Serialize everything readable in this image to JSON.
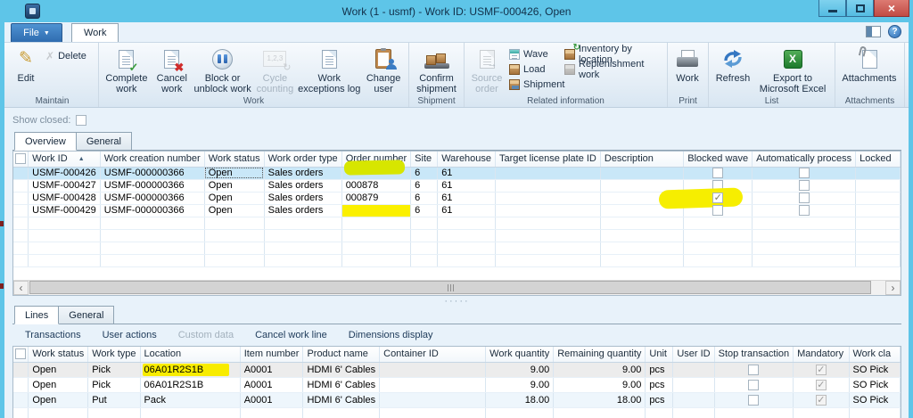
{
  "window": {
    "title": "Work (1 - usmf) - Work ID: USMF-000426, Open"
  },
  "titlebar": {
    "close_glyph": "×"
  },
  "icons": {
    "check": "✓",
    "cross": "✖",
    "arrow": "→",
    "cycle": "↻"
  },
  "tabrow": {
    "file_label": "File",
    "file_caret": "▼",
    "work_tab": "Work",
    "help_glyph": "?"
  },
  "ribbon": {
    "maintain": {
      "group_label": "Maintain",
      "edit": "Edit",
      "edit_glyph": "✎",
      "delete": "Delete",
      "delete_glyph": "✗"
    },
    "work": {
      "group_label": "Work",
      "complete": "Complete work",
      "cancel": "Cancel work",
      "block": "Block or unblock work",
      "cycle": "Cycle counting",
      "cycle_icon_text": "1,2,3",
      "exceptions": "Work exceptions log",
      "change_user": "Change user"
    },
    "shipment_group": {
      "group_label": "Shipment",
      "confirm": "Confirm shipment"
    },
    "related": {
      "group_label": "Related information",
      "source_order": "Source order",
      "wave": "Wave",
      "load": "Load",
      "shipment": "Shipment",
      "inventory": "Inventory by location",
      "replenishment": "Replenishment work"
    },
    "print_group": {
      "group_label": "Print",
      "work_btn": "Work"
    },
    "list_group": {
      "group_label": "List",
      "refresh": "Refresh",
      "export_excel": "Export to Microsoft Excel"
    },
    "attachments_group": {
      "group_label": "Attachments",
      "attachments": "Attachments"
    }
  },
  "filters": {
    "show_closed_label": "Show closed:"
  },
  "work_pane": {
    "tabs": [
      "Overview",
      "General"
    ],
    "sort_glyph": "▲",
    "columns": [
      "Work ID",
      "Work creation number",
      "Work status",
      "Work order type",
      "Order number",
      "Site",
      "Warehouse",
      "Target license plate ID",
      "Description",
      "Blocked wave",
      "Automatically process",
      "Locked"
    ],
    "rows": [
      {
        "work_id": "USMF-000426",
        "creation_number": "USMF-000000366",
        "work_status": "Open",
        "work_order_type": "Sales orders",
        "order_number": "",
        "site": "6",
        "warehouse": "61",
        "target_lp": "",
        "description": "",
        "blocked_wave": false,
        "auto_process": false,
        "selected": true,
        "focus": "work_status",
        "hl": {
          "order_number": "top"
        }
      },
      {
        "work_id": "USMF-000427",
        "creation_number": "USMF-000000366",
        "work_status": "Open",
        "work_order_type": "Sales orders",
        "order_number": "000878",
        "site": "6",
        "warehouse": "61",
        "target_lp": "",
        "description": "",
        "blocked_wave": false,
        "auto_process": false
      },
      {
        "work_id": "USMF-000428",
        "creation_number": "USMF-000000366",
        "work_status": "Open",
        "work_order_type": "Sales orders",
        "order_number": "000879",
        "site": "6",
        "warehouse": "61",
        "target_lp": "",
        "description": "",
        "blocked_wave": true,
        "auto_process": false,
        "hl": {
          "blocked_wave": "blob"
        }
      },
      {
        "work_id": "USMF-000429",
        "creation_number": "USMF-000000366",
        "work_status": "Open",
        "work_order_type": "Sales orders",
        "order_number": "",
        "site": "6",
        "warehouse": "61",
        "target_lp": "",
        "description": "",
        "blocked_wave": false,
        "auto_process": false,
        "hl": {
          "order_number": "fill"
        }
      }
    ]
  },
  "splitter": {
    "dots": "·····"
  },
  "scrollbar": {
    "left_glyph": "‹",
    "right_glyph": "›"
  },
  "lines_pane": {
    "tabs": [
      "Lines",
      "General"
    ],
    "actions": [
      {
        "label": "Transactions",
        "enabled": true
      },
      {
        "label": "User actions",
        "enabled": true
      },
      {
        "label": "Custom data",
        "enabled": false
      },
      {
        "label": "Cancel work line",
        "enabled": true
      },
      {
        "label": "Dimensions display",
        "enabled": true
      }
    ],
    "columns": [
      "Work status",
      "Work type",
      "Location",
      "Item number",
      "Product name",
      "Container ID",
      "Work quantity",
      "Remaining quantity",
      "Unit",
      "User ID",
      "Stop transaction",
      "Mandatory",
      "Work cla"
    ],
    "rows": [
      {
        "work_status": "Open",
        "work_type": "Pick",
        "location": "06A01R2S1B",
        "item_number": "A0001",
        "product_name": "HDMI 6' Cables",
        "container_id": "",
        "work_qty": "9.00",
        "remaining_qty": "9.00",
        "unit": "pcs",
        "user_id": "",
        "stop_transaction": false,
        "mandatory": true,
        "work_class": "SO Pick",
        "selected": true,
        "hl": {
          "location": "text"
        }
      },
      {
        "work_status": "Open",
        "work_type": "Pick",
        "location": "06A01R2S1B",
        "item_number": "A0001",
        "product_name": "HDMI 6' Cables",
        "container_id": "",
        "work_qty": "9.00",
        "remaining_qty": "9.00",
        "unit": "pcs",
        "user_id": "",
        "stop_transaction": false,
        "mandatory": true,
        "work_class": "SO Pick"
      },
      {
        "work_status": "Open",
        "work_type": "Put",
        "location": "Pack",
        "item_number": "A0001",
        "product_name": "HDMI 6' Cables",
        "container_id": "",
        "work_qty": "18.00",
        "remaining_qty": "18.00",
        "unit": "pcs",
        "user_id": "",
        "stop_transaction": false,
        "mandatory": true,
        "work_class": "SO Pick",
        "alt": true
      }
    ]
  }
}
